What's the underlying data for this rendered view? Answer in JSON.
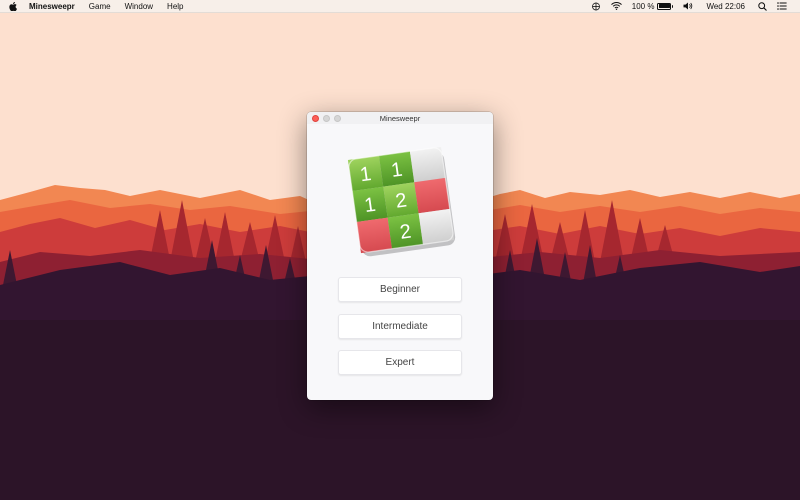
{
  "menubar": {
    "app_name": "Minesweepr",
    "items": [
      "Game",
      "Window",
      "Help"
    ],
    "battery_percent_label": "100 %",
    "battery_level": 100,
    "clock": "Wed 22:06"
  },
  "window": {
    "title": "Minesweepr"
  },
  "app_icon": {
    "cells": [
      "1",
      "1",
      "",
      "1",
      "2",
      "",
      "",
      "2",
      ""
    ]
  },
  "buttons": {
    "beginner": "Beginner",
    "intermediate": "Intermediate",
    "expert": "Expert"
  },
  "colors": {
    "wallpaper_sky": "#fde0cf",
    "mountains_far": "#ee7a4a",
    "mountains_mid": "#c8393b",
    "forest_dark": "#2c1428",
    "close_button": "#fd5f58",
    "cell_green": "#7cc243",
    "cell_red": "#e85a5f",
    "cell_gray": "#d9d9d9"
  }
}
